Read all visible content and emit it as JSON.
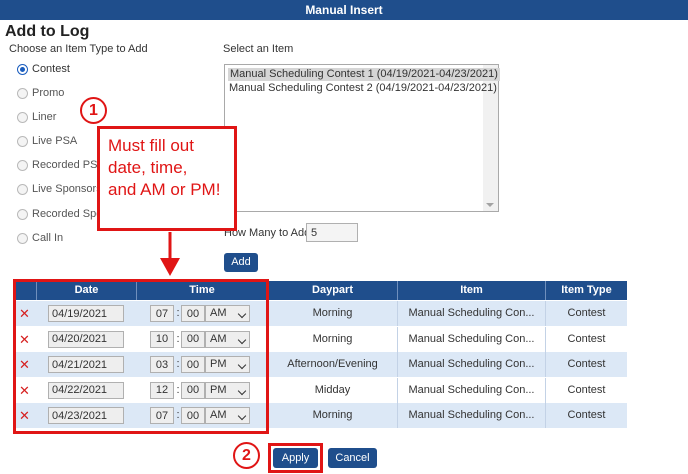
{
  "window": {
    "title": "Manual Insert"
  },
  "heading": "Add to Log",
  "item_type": {
    "label": "Choose an Item Type to Add",
    "options": [
      {
        "label": "Contest",
        "checked": true
      },
      {
        "label": "Promo",
        "checked": false
      },
      {
        "label": "Liner",
        "checked": false
      },
      {
        "label": "Live PSA",
        "checked": false
      },
      {
        "label": "Recorded PSA",
        "checked": false
      },
      {
        "label": "Live Sponsorsh",
        "checked": false
      },
      {
        "label": "Recorded Spor",
        "checked": false
      },
      {
        "label": "Call In",
        "checked": false
      }
    ]
  },
  "select_item": {
    "label": "Select an Item",
    "options": [
      {
        "label": "Manual Scheduling Contest 1 (04/19/2021-04/23/2021)",
        "selected": true
      },
      {
        "label": "Manual Scheduling Contest 2 (04/19/2021-04/23/2021)",
        "selected": false
      }
    ]
  },
  "how_many": {
    "label": "How Many to Add",
    "value": "5"
  },
  "buttons": {
    "add": "Add",
    "apply": "Apply",
    "cancel": "Cancel"
  },
  "table": {
    "headers": [
      "",
      "Date",
      "Time",
      "Daypart",
      "Item",
      "Item Type"
    ],
    "rows": [
      {
        "date": "04/19/2021",
        "hour": "07",
        "minute": "00",
        "ampm": "AM",
        "daypart": "Morning",
        "item": "Manual Scheduling Con...",
        "item_type": "Contest"
      },
      {
        "date": "04/20/2021",
        "hour": "10",
        "minute": "00",
        "ampm": "AM",
        "daypart": "Morning",
        "item": "Manual Scheduling Con...",
        "item_type": "Contest"
      },
      {
        "date": "04/21/2021",
        "hour": "03",
        "minute": "00",
        "ampm": "PM",
        "daypart": "Afternoon/Evening",
        "item": "Manual Scheduling Con...",
        "item_type": "Contest"
      },
      {
        "date": "04/22/2021",
        "hour": "12",
        "minute": "00",
        "ampm": "PM",
        "daypart": "Midday",
        "item": "Manual Scheduling Con...",
        "item_type": "Contest"
      },
      {
        "date": "04/23/2021",
        "hour": "07",
        "minute": "00",
        "ampm": "AM",
        "daypart": "Morning",
        "item": "Manual Scheduling Con...",
        "item_type": "Contest"
      }
    ]
  },
  "annotations": {
    "step1": "1",
    "step2": "2",
    "callout_lines": [
      "Must fill out",
      "date, time,",
      "and AM or PM!"
    ]
  },
  "colors": {
    "header_blue": "#1f4e8c",
    "annotation_red": "#e01515",
    "row_alt": "#dce8f6"
  }
}
